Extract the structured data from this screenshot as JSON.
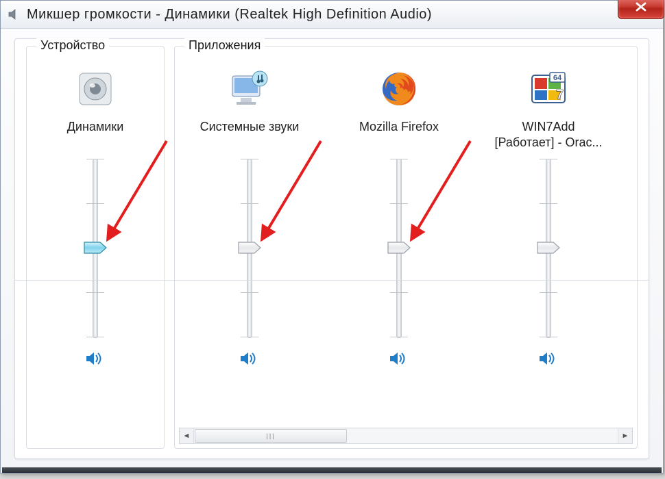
{
  "window": {
    "title": "Микшер громкости - Динамики (Realtek High Definition Audio)"
  },
  "device_section": {
    "legend": "Устройство"
  },
  "apps_section": {
    "legend": "Приложения"
  },
  "columns": {
    "device": {
      "label": "Динамики",
      "slider_value": 50,
      "thumb_style": "cyan"
    },
    "system_sounds": {
      "label": "Системные звуки",
      "slider_value": 50,
      "thumb_style": "gray"
    },
    "firefox": {
      "label": "Mozilla Firefox",
      "slider_value": 50,
      "thumb_style": "gray"
    },
    "win7add": {
      "label": "WIN7Add\n[Работает] - Orac...",
      "slider_value": 50,
      "thumb_style": "gray"
    }
  },
  "icons": {
    "title": "speaker-icon",
    "close": "close-icon",
    "device": "speaker-device-icon",
    "system_sounds": "system-sounds-icon",
    "firefox": "firefox-icon",
    "win7add": "virtualbox-icon",
    "mute": "speaker-unmuted-icon"
  },
  "colors": {
    "accent": "#1f7ec7",
    "arrow": "#e31e1e"
  }
}
